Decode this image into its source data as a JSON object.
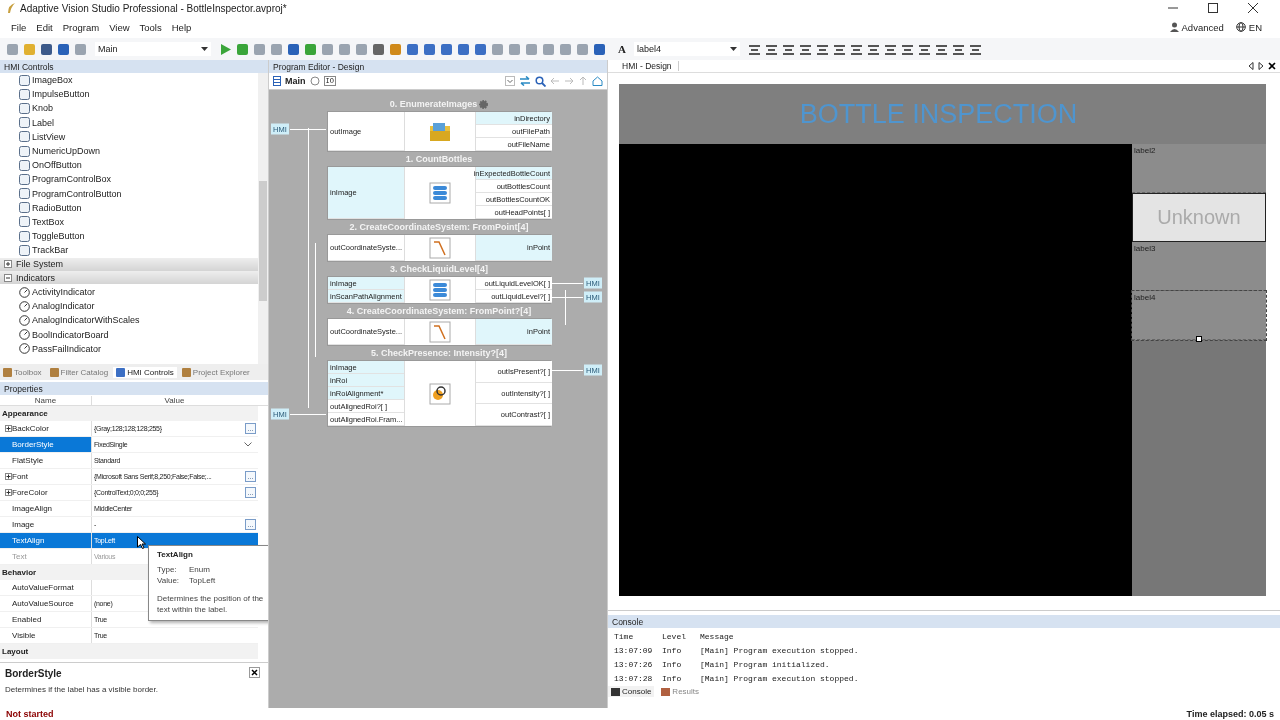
{
  "window": {
    "title": "Adaptive Vision Studio Professional - BottleInspector.avproj*"
  },
  "menu": [
    "File",
    "Edit",
    "Program",
    "View",
    "Tools",
    "Help"
  ],
  "user_mode": "Advanced",
  "language": "EN",
  "toolbar": {
    "program": "Main",
    "label_selector": "label4",
    "label_glyph": "A"
  },
  "hmi_controls": {
    "title": "HMI Controls",
    "items": [
      {
        "label": "ImageBox"
      },
      {
        "label": "ImpulseButton"
      },
      {
        "label": "Knob"
      },
      {
        "label": "Label"
      },
      {
        "label": "ListView"
      },
      {
        "label": "NumericUpDown"
      },
      {
        "label": "OnOffButton"
      },
      {
        "label": "ProgramControlBox"
      },
      {
        "label": "ProgramControlButton"
      },
      {
        "label": "RadioButton"
      },
      {
        "label": "TextBox"
      },
      {
        "label": "ToggleButton"
      },
      {
        "label": "TrackBar"
      }
    ],
    "groups": [
      {
        "label": "File System",
        "expanded": false
      },
      {
        "label": "Indicators",
        "expanded": true,
        "children": [
          {
            "label": "ActivityIndicator"
          },
          {
            "label": "AnalogIndicator"
          },
          {
            "label": "AnalogIndicatorWithScales"
          },
          {
            "label": "BoolIndicatorBoard"
          },
          {
            "label": "PassFailIndicator"
          }
        ]
      }
    ],
    "tabs": [
      {
        "label": "Toolbox",
        "selected": false
      },
      {
        "label": "Filter Catalog",
        "selected": false
      },
      {
        "label": "HMI Controls",
        "selected": true
      },
      {
        "label": "Project Explorer",
        "selected": false
      }
    ]
  },
  "properties": {
    "title": "Properties",
    "columns": [
      "Name",
      "Value"
    ],
    "categories": [
      {
        "label": "Appearance",
        "rows": [
          {
            "name": "BackColor",
            "value": "{Gray;128;128;128;255}",
            "expandable": true,
            "button": "...",
            "selected": false,
            "hovered": false,
            "disabled": false
          },
          {
            "name": "BorderStyle",
            "value": "FixedSingle",
            "dropdown": true,
            "selected": true,
            "hovered": false,
            "disabled": false
          },
          {
            "name": "FlatStyle",
            "value": "Standard",
            "selected": false,
            "hovered": false,
            "disabled": false
          },
          {
            "name": "Font",
            "value": "{Microsoft Sans Serif;8,250;False;False;...",
            "expandable": true,
            "button": "...",
            "selected": false,
            "hovered": false,
            "disabled": false
          },
          {
            "name": "ForeColor",
            "value": "{ControlText;0;0;0;255}",
            "expandable": true,
            "button": "...",
            "selected": false,
            "hovered": false,
            "disabled": false
          },
          {
            "name": "ImageAlign",
            "value": "MiddleCenter",
            "selected": false,
            "hovered": false,
            "disabled": false
          },
          {
            "name": "Image",
            "value": "-",
            "button": "...",
            "selected": false,
            "hovered": false,
            "disabled": false
          },
          {
            "name": "TextAlign",
            "value": "TopLeft",
            "selected": true,
            "hovered": true,
            "disabled": false
          },
          {
            "name": "Text",
            "value": "Various",
            "selected": false,
            "hovered": false,
            "disabled": true
          }
        ]
      },
      {
        "label": "Behavior",
        "rows": [
          {
            "name": "AutoValueFormat",
            "value": "",
            "selected": false,
            "hovered": false,
            "disabled": false
          },
          {
            "name": "AutoValueSource",
            "value": "(none)",
            "selected": false,
            "hovered": false,
            "disabled": false
          },
          {
            "name": "Enabled",
            "value": "True",
            "selected": false,
            "hovered": false,
            "disabled": false
          },
          {
            "name": "Visible",
            "value": "True",
            "selected": false,
            "hovered": false,
            "disabled": false
          }
        ]
      },
      {
        "label": "Layout"
      }
    ],
    "tooltip": {
      "title": "TextAlign",
      "type_label": "Type:",
      "type": "Enum",
      "value_label": "Value:",
      "value": "TopLeft",
      "description": "Determines the position of the text within the label."
    },
    "help": {
      "title": "BorderStyle",
      "text": "Determines if the label has a visible border."
    }
  },
  "program_editor": {
    "title": "Program Editor - Design",
    "path": "Main",
    "io": "IO",
    "blocks": [
      {
        "title": "0. EnumerateImages",
        "kind": "source",
        "settings": true,
        "left": [
          {
            "name": "outImage",
            "kind": "out",
            "link": "HMI"
          }
        ],
        "right": [
          {
            "name": "inDirectory",
            "kind": "in"
          },
          {
            "name": "outFilePath",
            "kind": "out"
          },
          {
            "name": "outFileName",
            "kind": "out"
          }
        ]
      },
      {
        "title": "1. CountBottles",
        "kind": "list",
        "settings": false,
        "left": [
          {
            "name": "inImage",
            "kind": "in"
          }
        ],
        "right": [
          {
            "name": "inExpectedBottleCount",
            "kind": "in"
          },
          {
            "name": "outBottlesCount",
            "kind": "out"
          },
          {
            "name": "outBottlesCountOK",
            "kind": "out"
          },
          {
            "name": "outHeadPoints[ ]",
            "kind": "out"
          }
        ]
      },
      {
        "title": "2. CreateCoordinateSystem: FromPoint[4]",
        "kind": "coordinate",
        "settings": false,
        "left": [
          {
            "name": "outCoordinateSyste...",
            "kind": "out"
          }
        ],
        "right": [
          {
            "name": "inPoint",
            "kind": "in"
          }
        ]
      },
      {
        "title": "3. CheckLiquidLevel[4]",
        "kind": "list",
        "settings": false,
        "left": [
          {
            "name": "inImage",
            "kind": "in"
          },
          {
            "name": "inScanPathAlignment",
            "kind": "in"
          }
        ],
        "right": [
          {
            "name": "outLiquidLevelOK[ ]",
            "kind": "out",
            "link": "HMI"
          },
          {
            "name": "outLiquidLevel?[ ]",
            "kind": "out",
            "link": "HMI"
          }
        ]
      },
      {
        "title": "4. CreateCoordinateSystem: FromPoint?[4]",
        "kind": "coordinate",
        "settings": false,
        "left": [
          {
            "name": "outCoordinateSyste...",
            "kind": "out"
          }
        ],
        "right": [
          {
            "name": "inPoint",
            "kind": "in"
          }
        ]
      },
      {
        "title": "5. CheckPresence: Intensity?[4]",
        "kind": "inspect",
        "settings": false,
        "left": [
          {
            "name": "inImage",
            "kind": "in"
          },
          {
            "name": "inRoi",
            "kind": "in"
          },
          {
            "name": "inRoiAlignment*",
            "kind": "in"
          },
          {
            "name": "outAlignedRoi?[ ]",
            "kind": "out"
          },
          {
            "name": "outAlignedRoi.Fram...",
            "kind": "out",
            "link": "HMI"
          }
        ],
        "right": [
          {
            "name": "outIsPresent?[ ]",
            "kind": "out",
            "link": "HMI"
          },
          {
            "name": "outIntensity?[ ]",
            "kind": "out"
          },
          {
            "name": "outContrast?[ ]",
            "kind": "out"
          }
        ]
      }
    ]
  },
  "hmi_design": {
    "tab": "HMI - Design",
    "title": "BOTTLE INSPECTION",
    "labels": [
      {
        "text": "label2",
        "kind": "label",
        "selected": false
      },
      {
        "text": "Unknown",
        "kind": "result",
        "selected": false
      },
      {
        "text": "label3",
        "kind": "label",
        "selected": false
      },
      {
        "text": "label4",
        "kind": "label",
        "selected": true
      }
    ]
  },
  "console": {
    "title": "Console",
    "columns": [
      "Time",
      "Level",
      "Message"
    ],
    "rows": [
      {
        "time": "13:07:09",
        "level": "Info",
        "message": "[Main] Program execution stopped."
      },
      {
        "time": "13:07:26",
        "level": "Info",
        "message": "[Main] Program initialized."
      },
      {
        "time": "13:07:28",
        "level": "Info",
        "message": "[Main] Program execution stopped."
      }
    ],
    "tabs": [
      {
        "label": "Console",
        "selected": true
      },
      {
        "label": "Results",
        "selected": false
      }
    ]
  },
  "status_bar": {
    "state": "Not started",
    "elapsed": "Time elapsed: 0.05 s"
  }
}
